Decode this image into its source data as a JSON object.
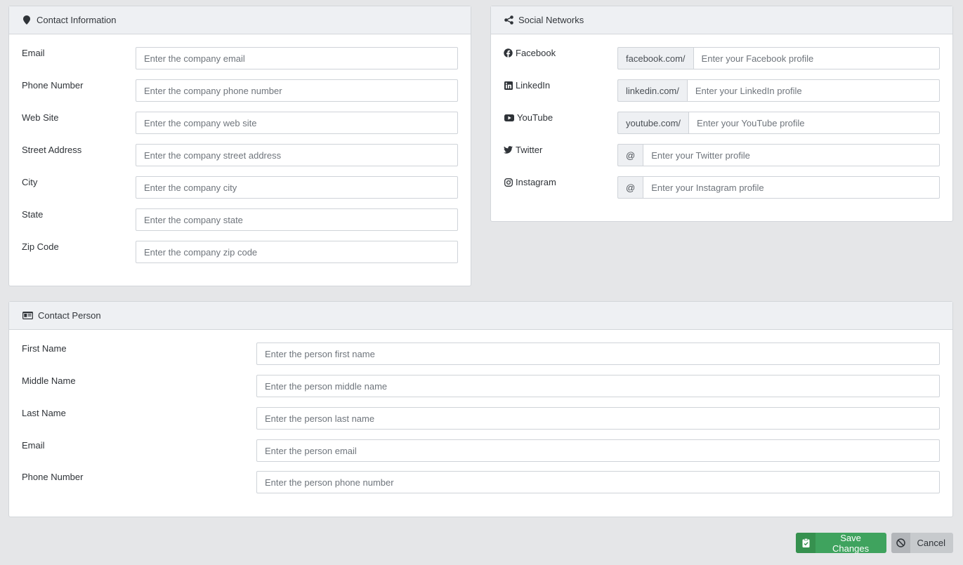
{
  "contact_info": {
    "title": "Contact Information",
    "fields": [
      {
        "label": "Email",
        "placeholder": "Enter the company email"
      },
      {
        "label": "Phone Number",
        "placeholder": "Enter the company phone number"
      },
      {
        "label": "Web Site",
        "placeholder": "Enter the company web site"
      },
      {
        "label": "Street Address",
        "placeholder": "Enter the company street address"
      },
      {
        "label": "City",
        "placeholder": "Enter the company city"
      },
      {
        "label": "State",
        "placeholder": "Enter the company state"
      },
      {
        "label": "Zip Code",
        "placeholder": "Enter the company zip code"
      }
    ]
  },
  "social": {
    "title": "Social Networks",
    "fields": [
      {
        "label": "Facebook",
        "icon": "facebook-icon",
        "prefix": "facebook.com/",
        "placeholder": "Enter your Facebook profile"
      },
      {
        "label": "LinkedIn",
        "icon": "linkedin-icon",
        "prefix": "linkedin.com/",
        "placeholder": "Enter your LinkedIn profile"
      },
      {
        "label": "YouTube",
        "icon": "youtube-icon",
        "prefix": "youtube.com/",
        "placeholder": "Enter your YouTube profile"
      },
      {
        "label": "Twitter",
        "icon": "twitter-icon",
        "prefix": "@",
        "placeholder": "Enter your Twitter profile"
      },
      {
        "label": "Instagram",
        "icon": "instagram-icon",
        "prefix": "@",
        "placeholder": "Enter your Instagram profile"
      }
    ]
  },
  "contact_person": {
    "title": "Contact Person",
    "fields": [
      {
        "label": "First Name",
        "placeholder": "Enter the person first name"
      },
      {
        "label": "Middle Name",
        "placeholder": "Enter the person middle name"
      },
      {
        "label": "Last Name",
        "placeholder": "Enter the person last name"
      },
      {
        "label": "Email",
        "placeholder": "Enter the person email"
      },
      {
        "label": "Phone Number",
        "placeholder": "Enter the person phone number"
      }
    ]
  },
  "actions": {
    "save_label": "Save Changes",
    "cancel_label": "Cancel"
  },
  "colors": {
    "save": "#3fa35e",
    "cancel": "#c7cacd",
    "header_bg": "#eef0f3",
    "page_bg": "#e5e6e8"
  }
}
